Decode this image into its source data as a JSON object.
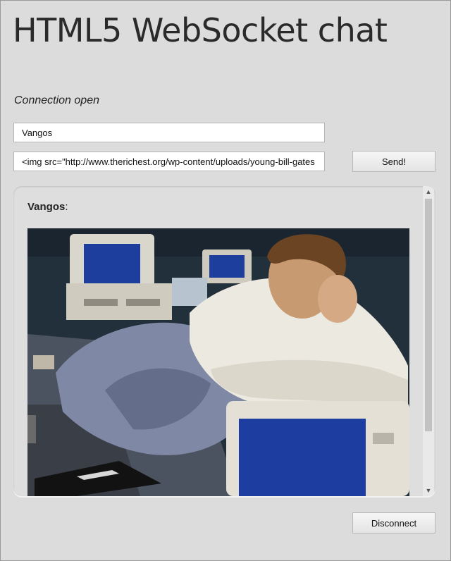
{
  "page": {
    "title": "HTML5 WebSocket chat",
    "status": "Connection open"
  },
  "form": {
    "name_value": "Vangos",
    "message_value": "<img src=\"http://www.therichest.org/wp-content/uploads/young-bill-gates",
    "send_label": "Send!"
  },
  "chat": {
    "messages": [
      {
        "sender": "Vangos",
        "separator": ":",
        "content_type": "image"
      }
    ]
  },
  "footer": {
    "disconnect_label": "Disconnect"
  },
  "scrollbar": {
    "up_icon": "▲",
    "down_icon": "▼"
  },
  "colors": {
    "background": "#dcdcdc",
    "field_bg": "#ffffff",
    "button_bg": "#eeeeee",
    "screen_blue": "#1f3f9a"
  }
}
